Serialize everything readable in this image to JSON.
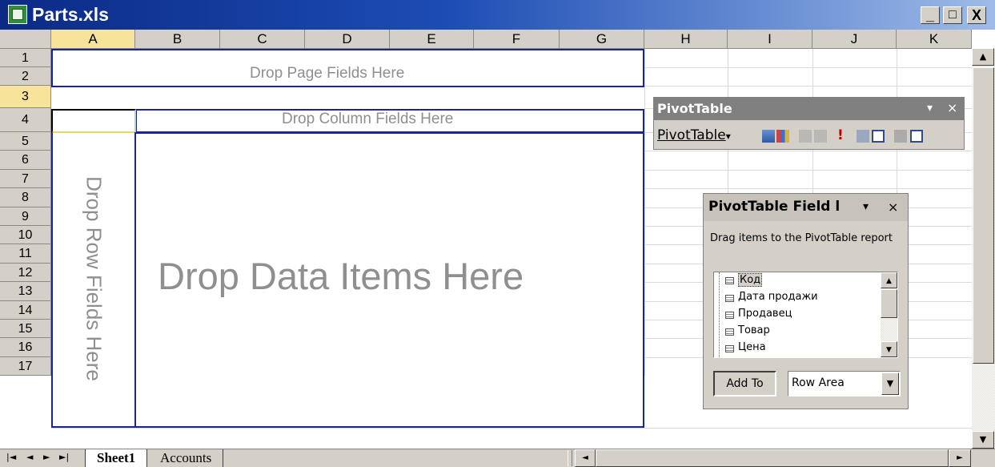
{
  "window": {
    "title": "Parts.xls",
    "minimize": "_",
    "maximize": "□",
    "close": "X"
  },
  "columns": [
    "A",
    "B",
    "C",
    "D",
    "E",
    "F",
    "G",
    "H",
    "I",
    "J",
    "K"
  ],
  "rows": [
    "1",
    "2",
    "3",
    "4",
    "5",
    "6",
    "7",
    "8",
    "9",
    "10",
    "11",
    "12",
    "13",
    "14",
    "15",
    "16",
    "17"
  ],
  "selected_cell": {
    "column": "A",
    "row": "3"
  },
  "pivot_layout": {
    "page_fields": "Drop Page Fields Here",
    "column_fields": "Drop Column Fields Here",
    "row_fields": "Drop Row Fields Here",
    "data_items": "Drop Data Items Here"
  },
  "pivot_toolbar": {
    "title": "PivotTable",
    "menu_label": "PivotTable",
    "menu_arrow": "▾",
    "dropdown": "▾",
    "close": "×"
  },
  "field_list": {
    "title": "PivotTable Field l",
    "dropdown": "▾",
    "close": "×",
    "instructions": "Drag items to the PivotTable report",
    "items": [
      "Код",
      "Дата продажи",
      "Продавец",
      "Товар",
      "Цена"
    ],
    "add_to_label": "Add To",
    "area_value": "Row Area",
    "area_arrow": "▼"
  },
  "sheet_tabs": {
    "active": "Sheet1",
    "other": "Accounts"
  },
  "colors": {
    "title_bar_start": "#0b2a86",
    "title_bar_end": "#9ebbe8",
    "drop_border": "#1a2690",
    "drop_text": "#8f8f8f",
    "selection_header": "#f7e39a"
  }
}
